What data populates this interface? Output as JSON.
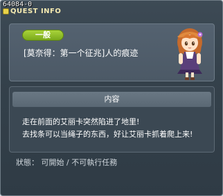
{
  "window": {
    "id_label": "64084-0",
    "title": "QUEST INFO"
  },
  "quest": {
    "category": "一般",
    "name": "[莫奈得：第一个征兆]人的痕迹"
  },
  "content": {
    "header": "内容",
    "lines": [
      "走在前面的艾丽卡突然陷进了地里!",
      "去找条可以当绳子的东西，好让艾丽卡抓着爬上来!"
    ]
  },
  "status": {
    "text": "狀態： 可開始 / 不可執行任務"
  },
  "colors": {
    "badge_green": "#8fc12a",
    "title_gold": "#f4e9b0",
    "panel": "#4c5966"
  }
}
